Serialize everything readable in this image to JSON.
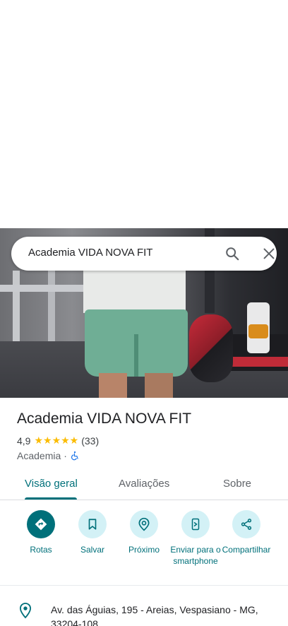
{
  "search": {
    "query": "Academia VIDA NOVA FIT"
  },
  "place": {
    "name": "Academia VIDA NOVA FIT",
    "rating": "4,9",
    "stars": "★★★★★",
    "review_count": "(33)",
    "category": "Academia",
    "separator": "·"
  },
  "tabs": [
    {
      "label": "Visão geral",
      "active": true
    },
    {
      "label": "Avaliações",
      "active": false
    },
    {
      "label": "Sobre",
      "active": false
    }
  ],
  "actions": [
    {
      "label": "Rotas",
      "icon": "directions-icon"
    },
    {
      "label": "Salvar",
      "icon": "bookmark-icon"
    },
    {
      "label": "Próximo",
      "icon": "nearby-icon"
    },
    {
      "label": "Enviar para o smartphone",
      "icon": "send-to-phone-icon"
    },
    {
      "label": "Compartilhar",
      "icon": "share-icon"
    }
  ],
  "address": {
    "text": "Av. das Águias, 195 - Areias, Vespasiano - MG, 33204-108"
  },
  "colors": {
    "accent": "#00707a",
    "action_bg": "#d3f1f6",
    "star": "#fbbc04"
  }
}
